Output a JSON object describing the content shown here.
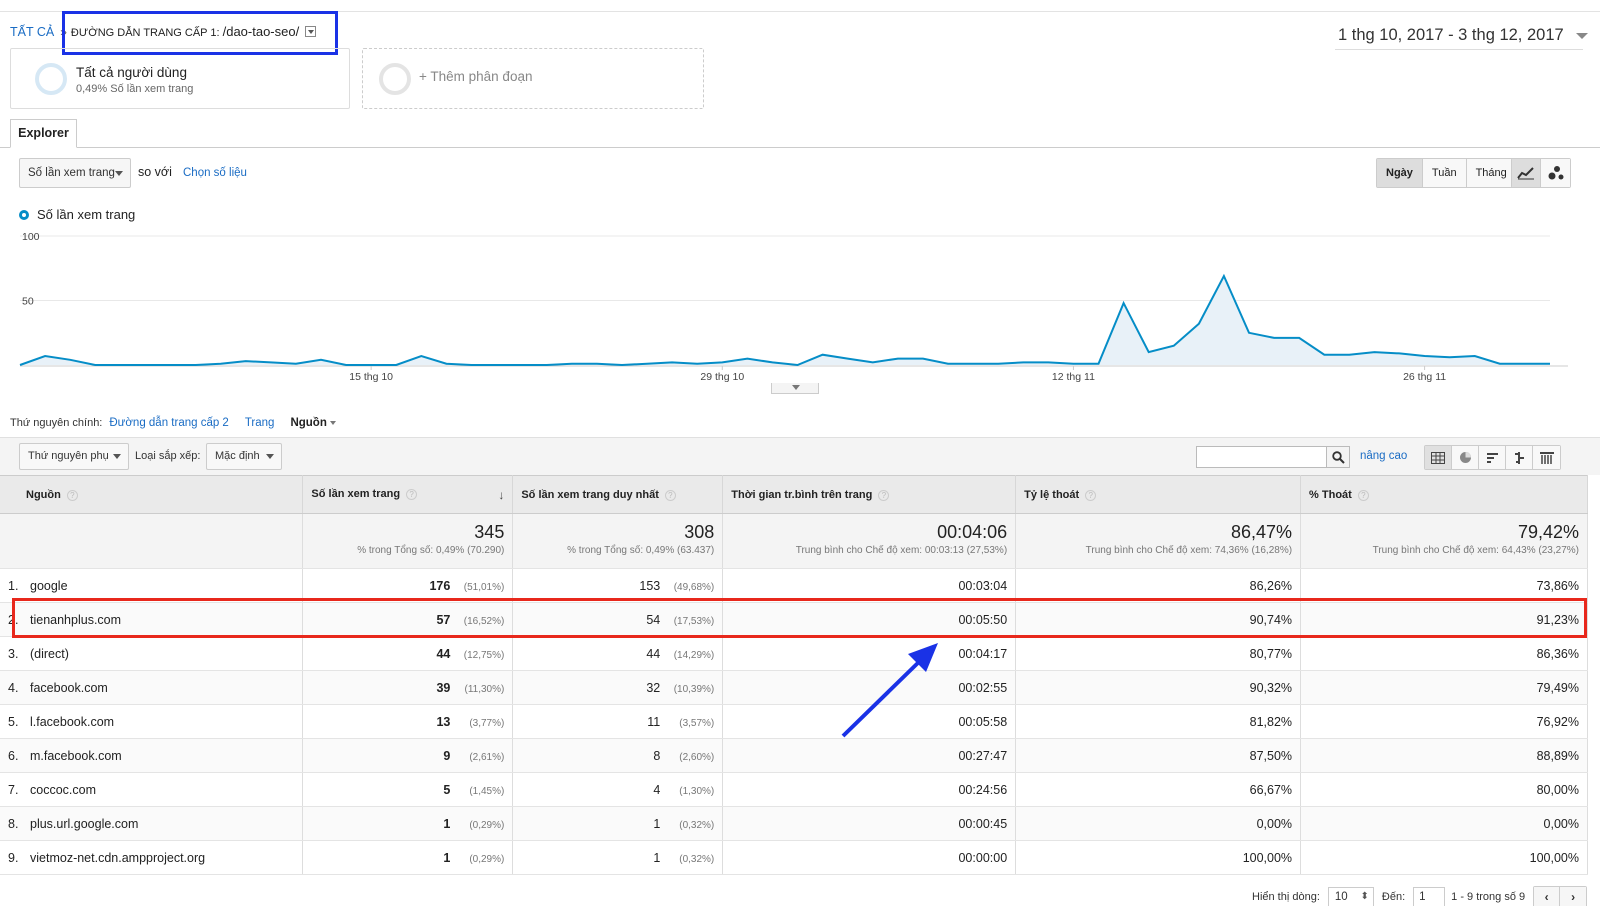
{
  "breadcrumb": {
    "root": "TẤT CẢ",
    "separator": "»",
    "dimension": "ĐƯỜNG DẪN TRANG CẤP 1:",
    "value": "/dao-tao-seo/"
  },
  "date_range": "1 thg 10, 2017 - 3 thg 12, 2017",
  "segments": {
    "current": {
      "title": "Tất cả người dùng",
      "subtitle": "0,49% Số lần xem trang"
    },
    "add": "+ Thêm phân đoạn"
  },
  "tabs": {
    "explorer": "Explorer"
  },
  "metric_controls": {
    "metric": "Số lần xem trang",
    "compare_label": "so với",
    "choose_metric": "Chọn số liệu"
  },
  "time_buttons": {
    "day": "Ngày",
    "week": "Tuần",
    "month": "Tháng"
  },
  "legend": "Số lần xem trang",
  "chart_data": {
    "type": "area",
    "title": "",
    "series": [
      {
        "name": "Số lần xem trang",
        "values": [
          0,
          7,
          4,
          0,
          0,
          0,
          0,
          0,
          1,
          3,
          2,
          1,
          4,
          0,
          0,
          0,
          7,
          1,
          0,
          0,
          0,
          0,
          1,
          1,
          0,
          1,
          2,
          1,
          2,
          5,
          2,
          0,
          8,
          5,
          2,
          5,
          5,
          1,
          1,
          1,
          2,
          2,
          1,
          1,
          48,
          10,
          15,
          32,
          69,
          25,
          21,
          21,
          8,
          8,
          10,
          9,
          7,
          6,
          7,
          1,
          1,
          1
        ]
      }
    ],
    "x_tick_labels": [
      "15 thg 10",
      "29 thg 10",
      "12 thg 11",
      "26 thg 11"
    ],
    "y_tick_labels": [
      "100",
      "50"
    ],
    "ylim": [
      0,
      100
    ],
    "color": "#058dc7"
  },
  "dimension_bar": {
    "label": "Thứ nguyên chính:",
    "options": [
      "Đường dẫn trang cấp 2",
      "Trang"
    ],
    "active": "Nguồn"
  },
  "table_controls": {
    "secondary": "Thứ nguyên phụ",
    "sort_label": "Loại sắp xếp:",
    "sort_value": "Mặc định",
    "advanced": "nâng cao",
    "search_value": ""
  },
  "table": {
    "columns": [
      "Nguồn",
      "Số lần xem trang",
      "Số lần xem trang duy nhất",
      "Thời gian tr.bình trên trang",
      "Tỷ lệ thoát",
      "% Thoát"
    ],
    "totals": [
      {
        "value": "345",
        "sub": "% trong Tổng số: 0,49% (70.290)"
      },
      {
        "value": "308",
        "sub": "% trong Tổng số: 0,49% (63.437)"
      },
      {
        "value": "00:04:06",
        "sub": "Trung bình cho Chế độ xem: 00:03:13 (27,53%)"
      },
      {
        "value": "86,47%",
        "sub": "Trung bình cho Chế độ xem: 74,36% (16,28%)"
      },
      {
        "value": "79,42%",
        "sub": "Trung bình cho Chế độ xem: 64,43% (23,27%)"
      }
    ],
    "rows": [
      {
        "rank": "1.",
        "source": "google",
        "views": "176",
        "views_pct": "(51,01%)",
        "unique": "153",
        "unique_pct": "(49,68%)",
        "time": "00:03:04",
        "bounce": "86,26%",
        "exit": "73,86%"
      },
      {
        "rank": "2.",
        "source": "tienanhplus.com",
        "views": "57",
        "views_pct": "(16,52%)",
        "unique": "54",
        "unique_pct": "(17,53%)",
        "time": "00:05:50",
        "bounce": "90,74%",
        "exit": "91,23%"
      },
      {
        "rank": "3.",
        "source": "(direct)",
        "views": "44",
        "views_pct": "(12,75%)",
        "unique": "44",
        "unique_pct": "(14,29%)",
        "time": "00:04:17",
        "bounce": "80,77%",
        "exit": "86,36%"
      },
      {
        "rank": "4.",
        "source": "facebook.com",
        "views": "39",
        "views_pct": "(11,30%)",
        "unique": "32",
        "unique_pct": "(10,39%)",
        "time": "00:02:55",
        "bounce": "90,32%",
        "exit": "79,49%"
      },
      {
        "rank": "5.",
        "source": "l.facebook.com",
        "views": "13",
        "views_pct": "(3,77%)",
        "unique": "11",
        "unique_pct": "(3,57%)",
        "time": "00:05:58",
        "bounce": "81,82%",
        "exit": "76,92%"
      },
      {
        "rank": "6.",
        "source": "m.facebook.com",
        "views": "9",
        "views_pct": "(2,61%)",
        "unique": "8",
        "unique_pct": "(2,60%)",
        "time": "00:27:47",
        "bounce": "87,50%",
        "exit": "88,89%"
      },
      {
        "rank": "7.",
        "source": "coccoc.com",
        "views": "5",
        "views_pct": "(1,45%)",
        "unique": "4",
        "unique_pct": "(1,30%)",
        "time": "00:24:56",
        "bounce": "66,67%",
        "exit": "80,00%"
      },
      {
        "rank": "8.",
        "source": "plus.url.google.com",
        "views": "1",
        "views_pct": "(0,29%)",
        "unique": "1",
        "unique_pct": "(0,32%)",
        "time": "00:00:45",
        "bounce": "0,00%",
        "exit": "0,00%"
      },
      {
        "rank": "9.",
        "source": "vietmoz-net.cdn.ampproject.org",
        "views": "1",
        "views_pct": "(0,29%)",
        "unique": "1",
        "unique_pct": "(0,32%)",
        "time": "00:00:00",
        "bounce": "100,00%",
        "exit": "100,00%"
      }
    ]
  },
  "pager": {
    "show_rows_label": "Hiển thị dòng:",
    "rows_value": "10",
    "goto_label": "Đến:",
    "goto_value": "1",
    "range": "1 - 9 trong số 9"
  },
  "annotation_colors": {
    "blue_box": "#1a32e6",
    "red_box": "#e8281c",
    "arrow": "#1a32e6"
  }
}
